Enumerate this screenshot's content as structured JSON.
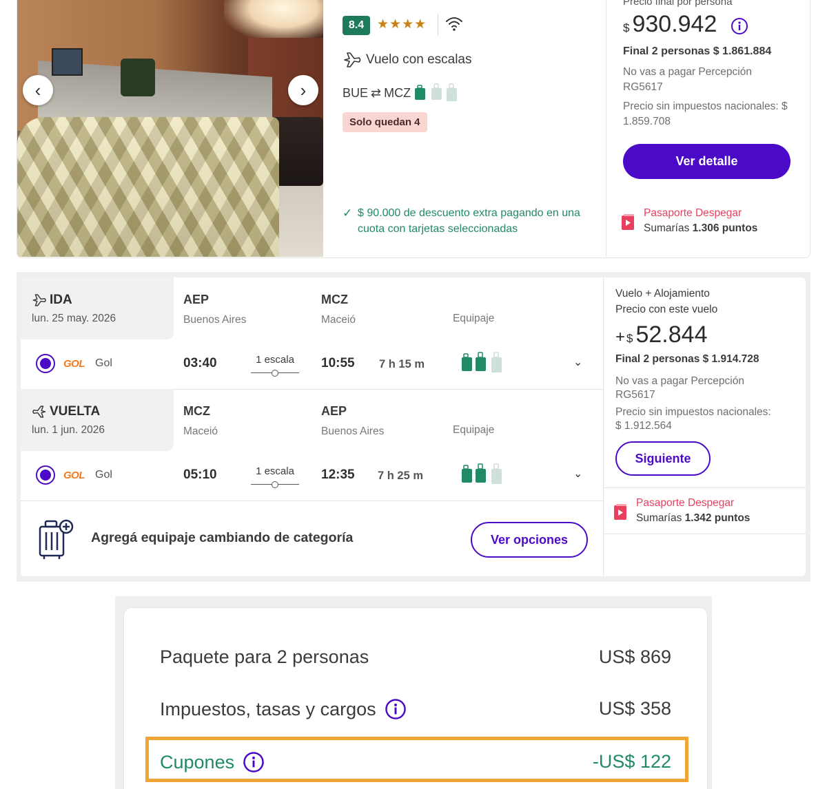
{
  "hotel_card": {
    "rating": "8.4",
    "stars": "★★★★",
    "flight_type": "Vuelo con escalas",
    "route_from": "BUE",
    "route_arrow": "⇄",
    "route_to": "MCZ",
    "availability": "Solo quedan 4",
    "discount_check": "✓",
    "discount_text": "$ 90.000 de descuento extra pagando en una cuota con tarjetas seleccionadas",
    "price_label": "Precio final por persona",
    "price_currency": "$",
    "price_amount": "930.942",
    "final_label": "Final 2 personas $ 1.861.884",
    "perception_text": "No vas a pagar Percepción RG5617",
    "no_taxes_text": "Precio sin impuestos nacionales: $ 1.859.708",
    "detail_button": "Ver detalle",
    "passport_title": "Pasaporte Despegar",
    "passport_prefix": "Sumarías",
    "passport_points": "1.306 puntos",
    "prev_arrow": "‹",
    "next_arrow": "›"
  },
  "flight_card": {
    "outbound": {
      "title": "IDA",
      "date": "lun. 25 may. 2026",
      "origin_code": "AEP",
      "origin_city": "Buenos Aires",
      "dest_code": "MCZ",
      "dest_city": "Maceió",
      "baggage_label": "Equipaje",
      "airline_logo": "GOL",
      "airline": "Gol",
      "depart": "03:40",
      "stops": "1 escala",
      "arrive": "10:55",
      "duration": "7 h 15 m"
    },
    "return": {
      "title": "VUELTA",
      "date": "lun. 1 jun. 2026",
      "origin_code": "MCZ",
      "origin_city": "Maceió",
      "dest_code": "AEP",
      "dest_city": "Buenos Aires",
      "baggage_label": "Equipaje",
      "airline_logo": "GOL",
      "airline": "Gol",
      "depart": "05:10",
      "stops": "1 escala",
      "arrive": "12:35",
      "duration": "7 h 25 m"
    },
    "chevron": "⌄",
    "baggage_prompt": "Agregá equipaje cambiando de categoría",
    "options_button": "Ver opciones",
    "price_type": "Vuelo + Alojamiento",
    "price_label": "Precio con este vuelo",
    "price_plus": "+",
    "price_currency": "$",
    "price_amount": "52.844",
    "final_label": "Final 2 personas  $ 1.914.728",
    "perception_text": "No vas a pagar Percepción RG5617",
    "no_taxes_text": "Precio sin impuestos nacionales: $ 1.912.564",
    "next_button": "Siguiente",
    "passport_title": "Pasaporte Despegar",
    "passport_prefix": "Sumarías",
    "passport_points": "1.342 puntos"
  },
  "summary_card": {
    "rows": [
      {
        "label": "Paquete para 2 personas",
        "value": "US$ 869"
      },
      {
        "label": "Impuestos, tasas y cargos",
        "value": "US$ 358"
      },
      {
        "label": "Cupones",
        "value": "-US$ 122"
      }
    ]
  },
  "colors": {
    "brand_purple": "#4b0ac8",
    "rating_green": "#1f7a5c",
    "discount_green": "#1f8a63",
    "passport_red": "#e8415f",
    "highlight_orange": "#f2a534"
  },
  "icons": [
    "wifi-icon",
    "plane-icon",
    "luggage-icon",
    "info-icon",
    "passport-icon",
    "suitcase-add-icon",
    "chevron-down-icon"
  ]
}
